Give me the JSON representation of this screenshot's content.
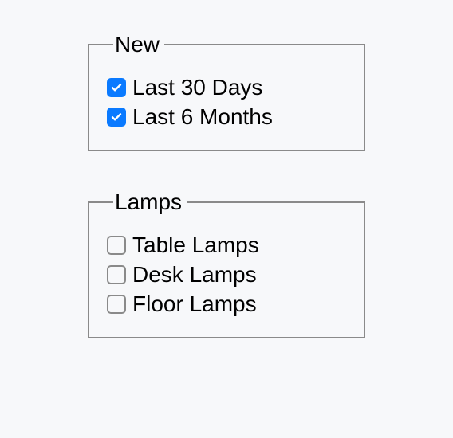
{
  "groups": [
    {
      "id": "new",
      "legend": "New",
      "options": [
        {
          "id": "last-30-days",
          "label": "Last 30 Days",
          "checked": true
        },
        {
          "id": "last-6-months",
          "label": "Last 6 Months",
          "checked": true
        }
      ]
    },
    {
      "id": "lamps",
      "legend": "Lamps",
      "options": [
        {
          "id": "table-lamps",
          "label": "Table Lamps",
          "checked": false
        },
        {
          "id": "desk-lamps",
          "label": "Desk Lamps",
          "checked": false
        },
        {
          "id": "floor-lamps",
          "label": "Floor Lamps",
          "checked": false
        }
      ]
    }
  ]
}
